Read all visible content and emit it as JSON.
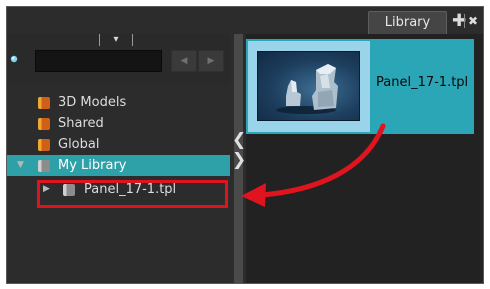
{
  "tabbar": {
    "tab_label": "Library",
    "add_glyph": "✚",
    "close_glyph": "✖"
  },
  "left_pane": {
    "view_toggle_glyph": "▾",
    "search": {
      "value": "",
      "placeholder": ""
    },
    "back_glyph": "◀",
    "forward_glyph": "▶",
    "tree": [
      {
        "label": "3D Models",
        "icon": "folder-orange-icon"
      },
      {
        "label": "Shared",
        "icon": "folder-orange-icon"
      },
      {
        "label": "Global",
        "icon": "folder-orange-icon"
      },
      {
        "label": "My Library",
        "icon": "folder-gray-icon",
        "expanded": true,
        "selected": true
      },
      {
        "label": "Panel_17-1.tpl",
        "icon": "folder-gray-icon",
        "child": true,
        "highlighted": true
      }
    ]
  },
  "splitter": {
    "collapse_glyph": "❮",
    "expand_glyph": "❯"
  },
  "right_pane": {
    "items": [
      {
        "name": "Panel_17-1.tpl",
        "selected": true
      }
    ]
  },
  "colors": {
    "selection": "#2ea0a8",
    "annotation_red": "#e0141e",
    "orange_folder": "#f0a830"
  }
}
